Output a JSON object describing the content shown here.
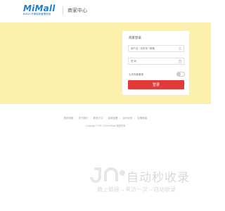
{
  "header": {
    "logo_main": "MiMall",
    "logo_sub": "B2B2C开源电商管理系统",
    "page_title": "商家中心"
  },
  "login": {
    "title": "商家登录",
    "username_placeholder": "用户名 / 手机号 / 邮箱",
    "password_placeholder": "密 码",
    "remember_label": "七天内免登录",
    "remember_on": false,
    "submit_label": "登录",
    "accent_color": "#e03a3a"
  },
  "banner": {
    "background": "#fcf0ad"
  },
  "footer": {
    "links": [
      "首页导航",
      "关于我们",
      "联系方式",
      "招商加盟",
      "合作伙伴",
      "友情链接"
    ],
    "copyright": "Copyright © 2017-2018  MiMall 版权所有"
  },
  "watermark": {
    "title": "自动秒收录",
    "subtitle": "做上链接→来访一次→自动收录"
  }
}
